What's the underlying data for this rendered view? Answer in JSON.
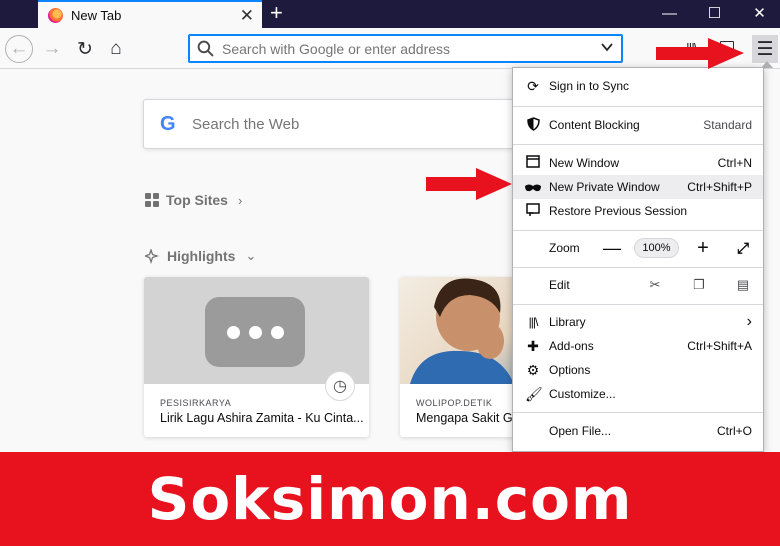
{
  "tab": {
    "title": "New Tab",
    "close": "✕",
    "new_tab": "+"
  },
  "window": {
    "minimize": "—",
    "maximize": "☐",
    "close": "✕"
  },
  "nav": {
    "back": "←",
    "forward": "→",
    "reload": "↻",
    "home": "⌂",
    "url_placeholder": "Search with Google or enter address",
    "menu": "☰"
  },
  "newtab": {
    "search_placeholder": "Search the Web",
    "google_letter": "G",
    "top_sites_label": "Top Sites",
    "top_sites_chevron": "›",
    "highlights_label": "Highlights",
    "highlights_chevron": "⌄",
    "cards": [
      {
        "source": "PESISIRKARYA",
        "title": "Lirik Lagu Ashira Zamita - Ku Cinta..."
      },
      {
        "source": "WOLIPOP.DETIK",
        "title": "Mengapa Sakit Gigi"
      }
    ]
  },
  "app_menu": {
    "sign_in": "Sign in to Sync",
    "content_blocking": "Content Blocking",
    "content_blocking_state": "Standard",
    "new_window": "New Window",
    "new_window_shortcut": "Ctrl+N",
    "new_private_window": "New Private Window",
    "new_private_window_shortcut": "Ctrl+Shift+P",
    "restore_session": "Restore Previous Session",
    "zoom_label": "Zoom",
    "zoom_minus": "—",
    "zoom_value": "100%",
    "zoom_plus": "+",
    "edit_label": "Edit",
    "library": "Library",
    "library_chevron": "›",
    "addons": "Add-ons",
    "addons_shortcut": "Ctrl+Shift+A",
    "options": "Options",
    "customize": "Customize...",
    "open_file": "Open File...",
    "open_file_shortcut": "Ctrl+O"
  },
  "banner": {
    "text": "Soksimon.com"
  },
  "colors": {
    "accent": "#0a84ff",
    "titlebar": "#1d1a3d",
    "banner": "#e8121e",
    "arrow": "#e8121e"
  }
}
